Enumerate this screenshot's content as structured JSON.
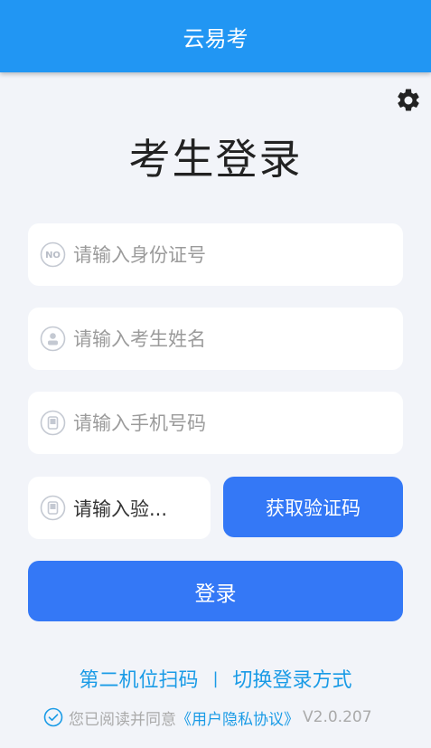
{
  "app": {
    "title": "云易考"
  },
  "page": {
    "heading": "考生登录"
  },
  "form": {
    "id_placeholder": "请输入身份证号",
    "name_placeholder": "请输入考生姓名",
    "phone_placeholder": "请输入手机号码",
    "code_placeholder": "请输入验...",
    "get_code_label": "获取验证码",
    "login_label": "登录",
    "id_badge": "NO"
  },
  "links": {
    "second_device": "第二机位扫码",
    "separator": "|",
    "switch_login": "切换登录方式"
  },
  "agreement": {
    "prefix": "您已阅读并同意",
    "policy": "《用户隐私协议》",
    "version": "V2.0.207"
  },
  "colors": {
    "appbar": "#2196f3",
    "primary_button": "#3478f6",
    "link": "#1a9be6",
    "background": "#f2f4f9"
  },
  "icons": {
    "settings": "gear-icon",
    "id": "id-card-icon",
    "name": "user-icon",
    "phone": "phone-icon",
    "code": "phone-icon",
    "agree": "check-circle-icon"
  }
}
